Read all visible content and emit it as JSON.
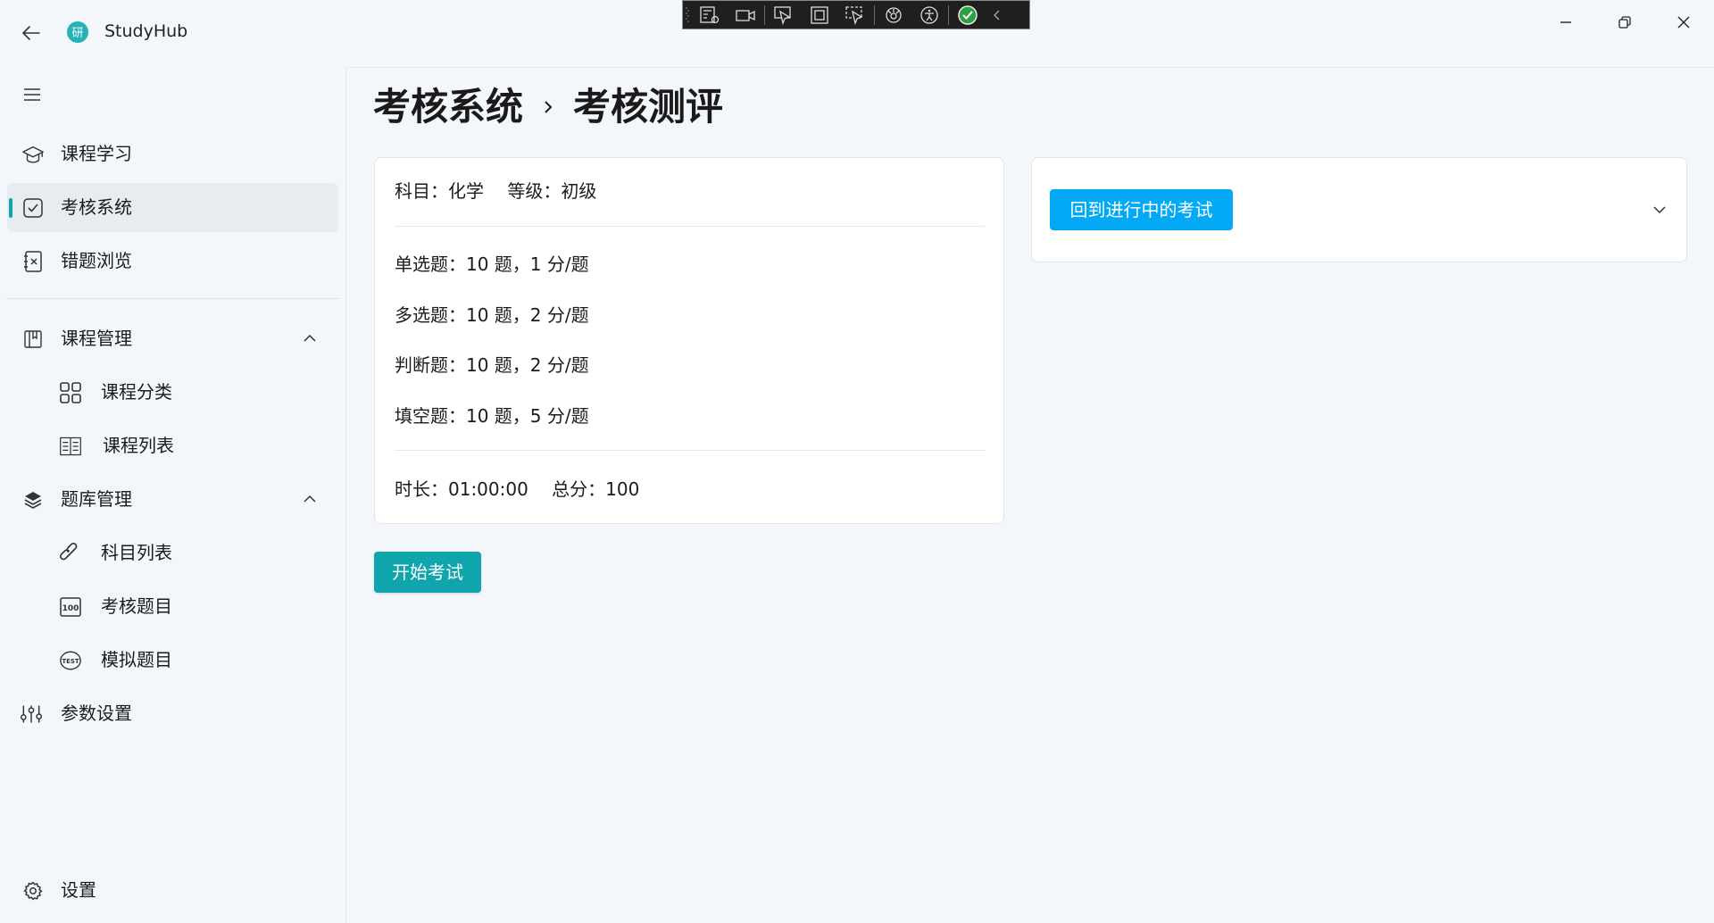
{
  "app": {
    "title": "StudyHub",
    "logo_char": "研"
  },
  "debug_toolbar": {
    "items": [
      "live-visual-tree",
      "record",
      "select-element",
      "display-layout-adorners",
      "track-focus",
      "hot-reload",
      "accessibility",
      "status-ok",
      "collapse"
    ]
  },
  "sidebar": {
    "items": [
      {
        "label": "课程学习"
      },
      {
        "label": "考核系统"
      },
      {
        "label": "错题浏览"
      },
      {
        "label": "课程管理"
      },
      {
        "label": "课程分类"
      },
      {
        "label": "课程列表"
      },
      {
        "label": "题库管理"
      },
      {
        "label": "科目列表"
      },
      {
        "label": "考核题目"
      },
      {
        "label": "模拟题目"
      },
      {
        "label": "参数设置"
      }
    ],
    "settings_label": "设置"
  },
  "breadcrumb": {
    "parent": "考核系统",
    "current": "考核测评"
  },
  "exam": {
    "header": "科目：化学　 等级：初级",
    "rows": [
      "单选题：10 题，1 分/题",
      "多选题：10 题，2 分/题",
      "判断题：10 题，2 分/题",
      "填空题：10 题，5 分/题"
    ],
    "footer": "时长：01:00:00　 总分：100",
    "start_label": "开始考试"
  },
  "resume": {
    "button_label": "回到进行中的考试"
  },
  "colors": {
    "accent": "#0fa5ad",
    "resume_button": "#03a9f4",
    "background": "#f3f7fc"
  }
}
